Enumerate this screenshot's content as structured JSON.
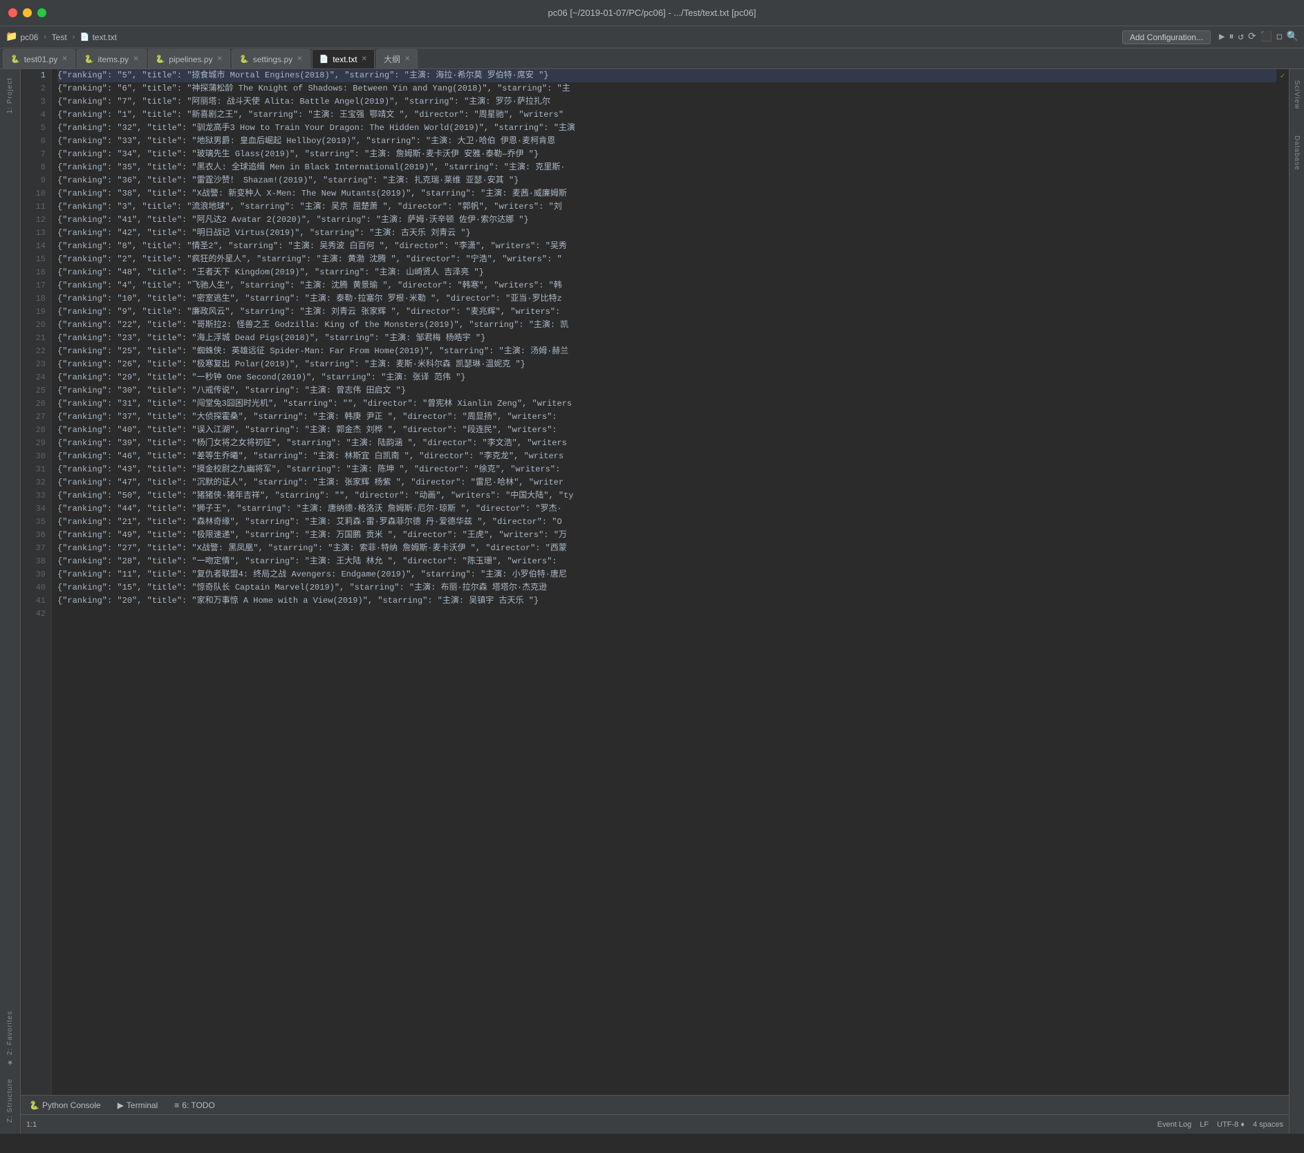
{
  "titleBar": {
    "title": "pc06 [~/2019-01-07/PC/pc06] - .../Test/text.txt [pc06]",
    "buttons": [
      "close",
      "minimize",
      "maximize"
    ]
  },
  "navBar": {
    "breadcrumb": [
      "pc06",
      "Test",
      "text.txt"
    ],
    "addConfigLabel": "Add Configuration...",
    "icons": [
      "▶",
      "⏸",
      "↺",
      "⟳",
      "⬛",
      "⬜",
      "🔍"
    ]
  },
  "tabs": [
    {
      "label": "test01.py",
      "active": false,
      "icon": "🐍"
    },
    {
      "label": "items.py",
      "active": false,
      "icon": "🐍"
    },
    {
      "label": "pipelines.py",
      "active": false,
      "icon": "🐍"
    },
    {
      "label": "settings.py",
      "active": false,
      "icon": "🐍"
    },
    {
      "label": "text.txt",
      "active": true,
      "icon": "📄"
    },
    {
      "label": "大纲",
      "active": false,
      "icon": ""
    }
  ],
  "leftSidebar": {
    "items": [
      "1: Project",
      "2: Favorites",
      "Z: Structure"
    ]
  },
  "rightSidebar": {
    "items": [
      "SciView",
      "Database"
    ]
  },
  "lines": [
    {
      "num": 1,
      "text": "{\"ranking\": \"5\", \"title\": \"掠食城市  Mortal Engines(2018)\", \"starring\": \"主演:  海拉·希尔莫  罗伯特·席安 \"}",
      "check": "✓"
    },
    {
      "num": 2,
      "text": "{\"ranking\": \"6\", \"title\": \"神探蒲松龄  The Knight of Shadows: Between Yin and Yang(2018)\", \"starring\": \"主"
    },
    {
      "num": 3,
      "text": "{\"ranking\": \"7\", \"title\": \"阿丽塔: 战斗天使  Alita: Battle Angel(2019)\", \"starring\": \"主演:  罗莎·萨拉扎尔 "
    },
    {
      "num": 4,
      "text": "{\"ranking\": \"1\", \"title\": \"新喜剧之王\", \"starring\": \"主演:  王宝强  鄂靖文 \", \"director\": \"周星驰\", \"writers\""
    },
    {
      "num": 5,
      "text": "{\"ranking\": \"32\", \"title\": \"驯龙高手3  How to Train Your Dragon: The Hidden World(2019)\", \"starring\": \"主演"
    },
    {
      "num": 6,
      "text": "{\"ranking\": \"33\", \"title\": \"地狱男爵:  皇血后崛起  Hellboy(2019)\", \"starring\": \"主演:  大卫·哈伯  伊恩·麦柯肯恩"
    },
    {
      "num": 7,
      "text": "{\"ranking\": \"34\", \"title\": \"玻璃先生  Glass(2019)\", \"starring\": \"主演:  詹姆斯·麦卡沃伊  安雅·泰勒—乔伊 \"}"
    },
    {
      "num": 8,
      "text": "{\"ranking\": \"35\", \"title\": \"黑衣人: 全球追缉  Men in Black International(2019)\", \"starring\": \"主演:  克里斯·"
    },
    {
      "num": 9,
      "text": "{\"ranking\": \"36\", \"title\": \"雷霆沙赞！  Shazam!(2019)\", \"starring\": \"主演:  扎克瑞·莱维  亚瑟·安其 \"}"
    },
    {
      "num": 10,
      "text": "{\"ranking\": \"38\", \"title\": \"X战警: 新变种人  X-Men: The New Mutants(2019)\", \"starring\": \"主演:  麦茜·威廉姆斯"
    },
    {
      "num": 11,
      "text": "{\"ranking\": \"3\", \"title\": \"流浪地球\", \"starring\": \"主演:  吴京  屈楚萧 \", \"director\": \"郭帆\", \"writers\": \"刘"
    },
    {
      "num": 12,
      "text": "{\"ranking\": \"41\", \"title\": \"阿凡达2  Avatar 2(2020)\", \"starring\": \"主演:  萨姆·沃辛顿  佐伊·索尔达娜 \"}"
    },
    {
      "num": 13,
      "text": "{\"ranking\": \"42\", \"title\": \"明日战记  Virtus(2019)\", \"starring\": \"主演:  古天乐  刘青云 \"}"
    },
    {
      "num": 14,
      "text": "{\"ranking\": \"8\", \"title\": \"情圣2\", \"starring\": \"主演:  吴秀波  白百何 \", \"director\": \"李潇\", \"writers\": \"吴秀"
    },
    {
      "num": 15,
      "text": "{\"ranking\": \"2\", \"title\": \"疯狂的外星人\", \"starring\": \"主演:  黄渤  沈腾 \", \"director\": \"宁浩\", \"writers\": \""
    },
    {
      "num": 16,
      "text": "{\"ranking\": \"48\", \"title\": \"王者天下  Kingdom(2019)\", \"starring\": \"主演:  山崎贤人  吉泽亮 \"}"
    },
    {
      "num": 17,
      "text": "{\"ranking\": \"4\", \"title\": \"飞驰人生\", \"starring\": \"主演:  沈腾  黄景瑜 \", \"director\": \"韩寒\", \"writers\": \"韩"
    },
    {
      "num": 18,
      "text": "{\"ranking\": \"10\", \"title\": \"密室逃生\", \"starring\": \"主演:  泰勒·拉塞尔  罗根·米勒 \", \"director\": \"亚当·罗比特z"
    },
    {
      "num": 19,
      "text": "{\"ranking\": \"9\", \"title\": \"廉政风云\", \"starring\": \"主演:  刘青云  张家辉 \", \"director\": \"麦兆辉\", \"writers\":"
    },
    {
      "num": 20,
      "text": "{\"ranking\": \"22\", \"title\": \"哥斯拉2: 怪兽之王  Godzilla: King of the Monsters(2019)\", \"starring\": \"主演:  凯"
    },
    {
      "num": 21,
      "text": "{\"ranking\": \"23\", \"title\": \"海上浮城  Dead Pigs(2018)\", \"starring\": \"主演:  邹君梅  杨皓宇 \"}"
    },
    {
      "num": 22,
      "text": "{\"ranking\": \"25\", \"title\": \"蜘蛛侠: 英雄远征  Spider-Man: Far From Home(2019)\", \"starring\": \"主演:  汤姆·赫兰"
    },
    {
      "num": 23,
      "text": "{\"ranking\": \"26\", \"title\": \"极寒复出  Polar(2019)\", \"starring\": \"主演:  麦斯·米科尔森  凯瑟琳·温妮克 \"}"
    },
    {
      "num": 24,
      "text": "{\"ranking\": \"29\", \"title\": \"一秒钟  One Second(2019)\", \"starring\": \"主演:  张译  范伟 \"}"
    },
    {
      "num": 25,
      "text": "{\"ranking\": \"30\", \"title\": \"八戒传说\", \"starring\": \"主演:  曾志伟  田启文 \"}"
    },
    {
      "num": 26,
      "text": "{\"ranking\": \"31\", \"title\": \"闯堂兔3囧困时光机\", \"starring\": \"\", \"director\": \"曾宪林 Xianlin Zeng\", \"writers"
    },
    {
      "num": 27,
      "text": "{\"ranking\": \"37\", \"title\": \"大侦探霍桑\", \"starring\": \"主演:  韩庚  尹正 \", \"director\": \"周显扬\", \"writers\":"
    },
    {
      "num": 28,
      "text": "{\"ranking\": \"40\", \"title\": \"误入江湖\", \"starring\": \"主演:  郭金杰  刘桦 \", \"director\": \"段连民\", \"writers\":"
    },
    {
      "num": 29,
      "text": "{\"ranking\": \"39\", \"title\": \"杨门女将之女将初征\", \"starring\": \"主演:  陆韵涵 \", \"director\": \"李文浩\", \"writers"
    },
    {
      "num": 30,
      "text": "{\"ranking\": \"46\", \"title\": \"差等生乔曦\", \"starring\": \"主演:  林斯宜  白凯南 \", \"director\": \"李克龙\", \"writers"
    },
    {
      "num": 31,
      "text": "{\"ranking\": \"43\", \"title\": \"摸金校尉之九幽将军\", \"starring\": \"主演:  陈坤 \", \"director\": \"徐克\", \"writers\":"
    },
    {
      "num": 32,
      "text": "{\"ranking\": \"47\", \"title\": \"沉默的证人\", \"starring\": \"主演:  张家辉  杨紫 \", \"director\": \"雷尼·哈林\", \"writer"
    },
    {
      "num": 33,
      "text": "{\"ranking\": \"50\", \"title\": \"猪猪侠·猪年吉祥\", \"starring\": \"\", \"director\": \"动画\", \"writers\": \"中国大陆\", \"ty"
    },
    {
      "num": 34,
      "text": "{\"ranking\": \"44\", \"title\": \"狮子王\", \"starring\": \"主演:  唐纳德·格洛沃  詹姆斯·厄尔·琼斯 \", \"director\": \"罗杰·"
    },
    {
      "num": 35,
      "text": "{\"ranking\": \"21\", \"title\": \"森林奇缘\", \"starring\": \"主演:  艾莉森·雷·罗森菲尔德  丹·爱德华兹 \", \"director\": \"O"
    },
    {
      "num": 36,
      "text": "{\"ranking\": \"49\", \"title\": \"极限速递\", \"starring\": \"主演:  万国鹏  贡米 \", \"director\": \"王虎\", \"writers\": \"万"
    },
    {
      "num": 37,
      "text": "{\"ranking\": \"27\", \"title\": \"X战警: 黑凤凰\", \"starring\": \"主演:  索菲·特纳  詹姆斯·麦卡沃伊 \", \"director\": \"西蒙"
    },
    {
      "num": 38,
      "text": "{\"ranking\": \"28\", \"title\": \"一吻定情\", \"starring\": \"主演:  王大陆  林允 \", \"director\": \"陈玉珊\", \"writers\":"
    },
    {
      "num": 39,
      "text": "{\"ranking\": \"11\", \"title\": \"复仇者联盟4: 终局之战  Avengers: Endgame(2019)\", \"starring\": \"主演:  小罗伯特·唐尼"
    },
    {
      "num": 40,
      "text": "{\"ranking\": \"15\", \"title\": \"惊奇队长  Captain Marvel(2019)\", \"starring\": \"主演:  布丽·拉尔森  塔塔尔·杰克逊  "
    },
    {
      "num": 41,
      "text": "{\"ranking\": \"20\", \"title\": \"家和万事惊  A Home with a View(2019)\", \"starring\": \"主演:  吴镇宇  古天乐 \"}"
    },
    {
      "num": 42,
      "text": ""
    }
  ],
  "statusBar": {
    "position": "1:1",
    "lineEnding": "LF",
    "encoding": "UTF-8 ♦",
    "indent": "4 spaces",
    "eventLog": "Event Log"
  },
  "bottomTabs": [
    {
      "label": "Python Console",
      "icon": "🐍"
    },
    {
      "label": "Terminal",
      "icon": "▶"
    },
    {
      "label": "6: TODO",
      "icon": "≡"
    }
  ]
}
